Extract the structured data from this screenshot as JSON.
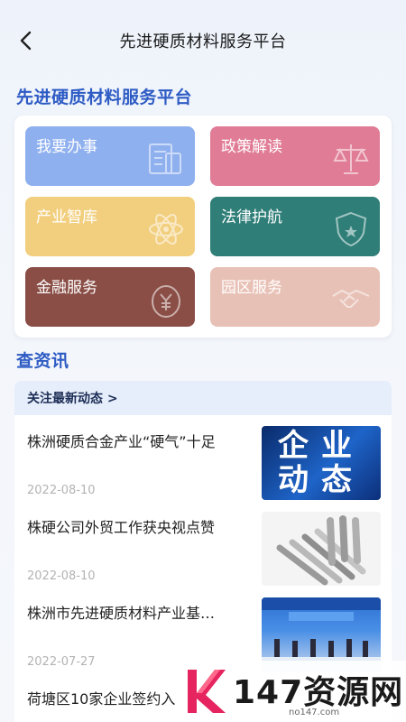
{
  "header": {
    "title": "先进硬质材料服务平台"
  },
  "platform": {
    "section_title": "先进硬质材料服务平台",
    "tiles": [
      {
        "label": "我要办事",
        "color": "#8fb0ef",
        "icon": "document-icon"
      },
      {
        "label": "政策解读",
        "color": "#e07c95",
        "icon": "scale-icon"
      },
      {
        "label": "产业智库",
        "color": "#f2cf7f",
        "icon": "atom-icon"
      },
      {
        "label": "法律护航",
        "color": "#2f7e78",
        "icon": "shield-icon"
      },
      {
        "label": "金融服务",
        "color": "#8a4e46",
        "icon": "yuan-coin-icon"
      },
      {
        "label": "园区服务",
        "color": "#e8c1b6",
        "icon": "handshake-icon"
      }
    ]
  },
  "news": {
    "section_title": "查资讯",
    "subheader": "关注最新动态 >",
    "items": [
      {
        "title": "株洲硬质合金产业“硬气”十足",
        "date": "2022-08-10",
        "thumb_text": "企业动态"
      },
      {
        "title": "株硬公司外贸工作获央视点赞",
        "date": "2022-08-10",
        "thumb_text": ""
      },
      {
        "title": "株洲市先进硬质材料产业基…",
        "date": "2022-07-27",
        "thumb_text": ""
      },
      {
        "title": "荷塘区10家企业签约入",
        "date": "",
        "thumb_text": ""
      }
    ]
  },
  "watermark": {
    "text": "147资源网",
    "sub": "no147.com"
  }
}
